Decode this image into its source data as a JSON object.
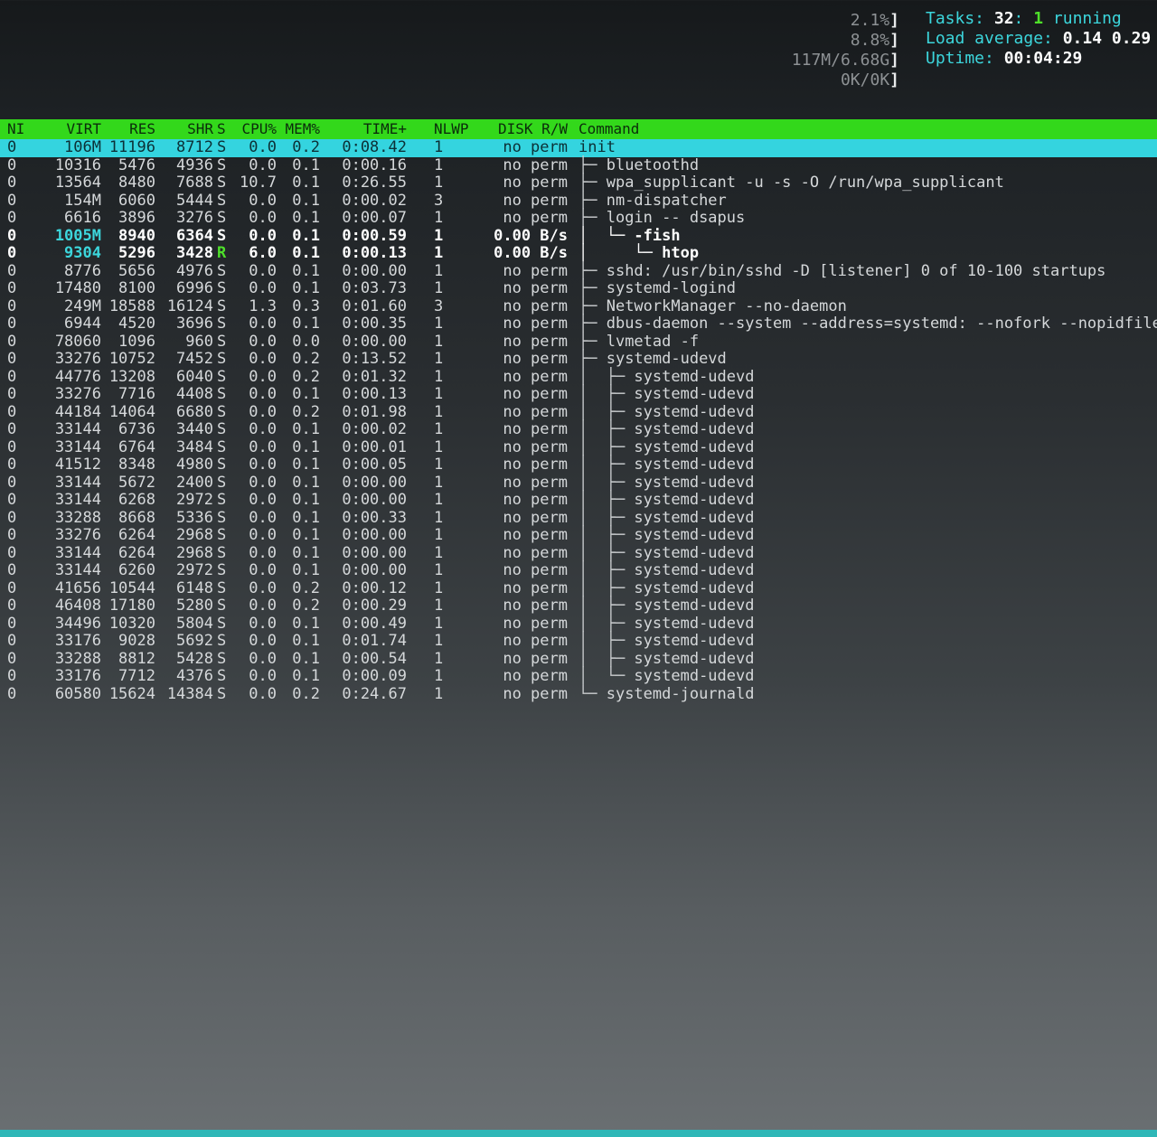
{
  "meters": [
    {
      "value": "2.1%",
      "bracket": "]"
    },
    {
      "value": "8.8%",
      "bracket": "]"
    },
    {
      "value": "117M/6.68G",
      "bracket": "]"
    },
    {
      "value": "0K/0K",
      "bracket": "]"
    }
  ],
  "sysinfo": {
    "tasks_label": "Tasks: ",
    "tasks_count": "32",
    "tasks_sep": ": ",
    "running_count": "1",
    "running_label": " running",
    "load_label": "Load average: ",
    "load_1": "0.14",
    "load_5": "0.29",
    "uptime_label": "Uptime: ",
    "uptime_value": "00:04:29"
  },
  "columns": {
    "ni": "NI",
    "virt": "VIRT",
    "res": "RES",
    "shr": "SHR",
    "s": "S",
    "cpu": "CPU%",
    "mem": "MEM%",
    "time": "TIME+",
    "nlwp": "NLWP",
    "disk": "DISK R/W",
    "command": "Command"
  },
  "processes": [
    {
      "ni": "0",
      "virt": "106M",
      "res": "11196",
      "shr": "8712",
      "s": "S",
      "cpu": "0.0",
      "mem": "0.2",
      "time": "0:08.42",
      "nlwp": "1",
      "disk": "no perm",
      "tree": "",
      "cmd": "init",
      "selected": true
    },
    {
      "ni": "0",
      "virt": "10316",
      "res": "5476",
      "shr": "4936",
      "s": "S",
      "cpu": "0.0",
      "mem": "0.1",
      "time": "0:00.16",
      "nlwp": "1",
      "disk": "no perm",
      "tree": "├─ ",
      "cmd": "bluetoothd"
    },
    {
      "ni": "0",
      "virt": "13564",
      "res": "8480",
      "shr": "7688",
      "s": "S",
      "cpu": "10.7",
      "mem": "0.1",
      "time": "0:26.55",
      "nlwp": "1",
      "disk": "no perm",
      "tree": "├─ ",
      "cmd": "wpa_supplicant -u -s -O /run/wpa_supplicant"
    },
    {
      "ni": "0",
      "virt": "154M",
      "res": "6060",
      "shr": "5444",
      "s": "S",
      "cpu": "0.0",
      "mem": "0.1",
      "time": "0:00.02",
      "nlwp": "3",
      "disk": "no perm",
      "tree": "├─ ",
      "cmd": "nm-dispatcher"
    },
    {
      "ni": "0",
      "virt": "6616",
      "res": "3896",
      "shr": "3276",
      "s": "S",
      "cpu": "0.0",
      "mem": "0.1",
      "time": "0:00.07",
      "nlwp": "1",
      "disk": "no perm",
      "tree": "├─ ",
      "cmd": "login -- dsapus"
    },
    {
      "ni": "0",
      "virt": "1005M",
      "res": "8940",
      "shr": "6364",
      "s": "S",
      "cpu": "0.0",
      "mem": "0.1",
      "time": "0:00.59",
      "nlwp": "1",
      "disk": "0.00 B/s",
      "tree": "│  └─ ",
      "cmd": "-fish",
      "bold": true
    },
    {
      "ni": "0",
      "virt": "9304",
      "res": "5296",
      "shr": "3428",
      "s": "R",
      "cpu": "6.0",
      "mem": "0.1",
      "time": "0:00.13",
      "nlwp": "1",
      "disk": "0.00 B/s",
      "tree": "│     └─ ",
      "cmd": "htop",
      "bold": true
    },
    {
      "ni": "0",
      "virt": "8776",
      "res": "5656",
      "shr": "4976",
      "s": "S",
      "cpu": "0.0",
      "mem": "0.1",
      "time": "0:00.00",
      "nlwp": "1",
      "disk": "no perm",
      "tree": "├─ ",
      "cmd": "sshd: /usr/bin/sshd -D [listener] 0 of 10-100 startups"
    },
    {
      "ni": "0",
      "virt": "17480",
      "res": "8100",
      "shr": "6996",
      "s": "S",
      "cpu": "0.0",
      "mem": "0.1",
      "time": "0:03.73",
      "nlwp": "1",
      "disk": "no perm",
      "tree": "├─ ",
      "cmd": "systemd-logind"
    },
    {
      "ni": "0",
      "virt": "249M",
      "res": "18588",
      "shr": "16124",
      "s": "S",
      "cpu": "1.3",
      "mem": "0.3",
      "time": "0:01.60",
      "nlwp": "3",
      "disk": "no perm",
      "tree": "├─ ",
      "cmd": "NetworkManager --no-daemon"
    },
    {
      "ni": "0",
      "virt": "6944",
      "res": "4520",
      "shr": "3696",
      "s": "S",
      "cpu": "0.0",
      "mem": "0.1",
      "time": "0:00.35",
      "nlwp": "1",
      "disk": "no perm",
      "tree": "├─ ",
      "cmd": "dbus-daemon --system --address=systemd: --nofork --nopidfile"
    },
    {
      "ni": "0",
      "virt": "78060",
      "res": "1096",
      "shr": "960",
      "s": "S",
      "cpu": "0.0",
      "mem": "0.0",
      "time": "0:00.00",
      "nlwp": "1",
      "disk": "no perm",
      "tree": "├─ ",
      "cmd": "lvmetad -f"
    },
    {
      "ni": "0",
      "virt": "33276",
      "res": "10752",
      "shr": "7452",
      "s": "S",
      "cpu": "0.0",
      "mem": "0.2",
      "time": "0:13.52",
      "nlwp": "1",
      "disk": "no perm",
      "tree": "├─ ",
      "cmd": "systemd-udevd"
    },
    {
      "ni": "0",
      "virt": "44776",
      "res": "13208",
      "shr": "6040",
      "s": "S",
      "cpu": "0.0",
      "mem": "0.2",
      "time": "0:01.32",
      "nlwp": "1",
      "disk": "no perm",
      "tree": "│  ├─ ",
      "cmd": "systemd-udevd"
    },
    {
      "ni": "0",
      "virt": "33276",
      "res": "7716",
      "shr": "4408",
      "s": "S",
      "cpu": "0.0",
      "mem": "0.1",
      "time": "0:00.13",
      "nlwp": "1",
      "disk": "no perm",
      "tree": "│  ├─ ",
      "cmd": "systemd-udevd"
    },
    {
      "ni": "0",
      "virt": "44184",
      "res": "14064",
      "shr": "6680",
      "s": "S",
      "cpu": "0.0",
      "mem": "0.2",
      "time": "0:01.98",
      "nlwp": "1",
      "disk": "no perm",
      "tree": "│  ├─ ",
      "cmd": "systemd-udevd"
    },
    {
      "ni": "0",
      "virt": "33144",
      "res": "6736",
      "shr": "3440",
      "s": "S",
      "cpu": "0.0",
      "mem": "0.1",
      "time": "0:00.02",
      "nlwp": "1",
      "disk": "no perm",
      "tree": "│  ├─ ",
      "cmd": "systemd-udevd"
    },
    {
      "ni": "0",
      "virt": "33144",
      "res": "6764",
      "shr": "3484",
      "s": "S",
      "cpu": "0.0",
      "mem": "0.1",
      "time": "0:00.01",
      "nlwp": "1",
      "disk": "no perm",
      "tree": "│  ├─ ",
      "cmd": "systemd-udevd"
    },
    {
      "ni": "0",
      "virt": "41512",
      "res": "8348",
      "shr": "4980",
      "s": "S",
      "cpu": "0.0",
      "mem": "0.1",
      "time": "0:00.05",
      "nlwp": "1",
      "disk": "no perm",
      "tree": "│  ├─ ",
      "cmd": "systemd-udevd"
    },
    {
      "ni": "0",
      "virt": "33144",
      "res": "5672",
      "shr": "2400",
      "s": "S",
      "cpu": "0.0",
      "mem": "0.1",
      "time": "0:00.00",
      "nlwp": "1",
      "disk": "no perm",
      "tree": "│  ├─ ",
      "cmd": "systemd-udevd"
    },
    {
      "ni": "0",
      "virt": "33144",
      "res": "6268",
      "shr": "2972",
      "s": "S",
      "cpu": "0.0",
      "mem": "0.1",
      "time": "0:00.00",
      "nlwp": "1",
      "disk": "no perm",
      "tree": "│  ├─ ",
      "cmd": "systemd-udevd"
    },
    {
      "ni": "0",
      "virt": "33288",
      "res": "8668",
      "shr": "5336",
      "s": "S",
      "cpu": "0.0",
      "mem": "0.1",
      "time": "0:00.33",
      "nlwp": "1",
      "disk": "no perm",
      "tree": "│  ├─ ",
      "cmd": "systemd-udevd"
    },
    {
      "ni": "0",
      "virt": "33276",
      "res": "6264",
      "shr": "2968",
      "s": "S",
      "cpu": "0.0",
      "mem": "0.1",
      "time": "0:00.00",
      "nlwp": "1",
      "disk": "no perm",
      "tree": "│  ├─ ",
      "cmd": "systemd-udevd"
    },
    {
      "ni": "0",
      "virt": "33144",
      "res": "6264",
      "shr": "2968",
      "s": "S",
      "cpu": "0.0",
      "mem": "0.1",
      "time": "0:00.00",
      "nlwp": "1",
      "disk": "no perm",
      "tree": "│  ├─ ",
      "cmd": "systemd-udevd"
    },
    {
      "ni": "0",
      "virt": "33144",
      "res": "6260",
      "shr": "2972",
      "s": "S",
      "cpu": "0.0",
      "mem": "0.1",
      "time": "0:00.00",
      "nlwp": "1",
      "disk": "no perm",
      "tree": "│  ├─ ",
      "cmd": "systemd-udevd"
    },
    {
      "ni": "0",
      "virt": "41656",
      "res": "10544",
      "shr": "6148",
      "s": "S",
      "cpu": "0.0",
      "mem": "0.2",
      "time": "0:00.12",
      "nlwp": "1",
      "disk": "no perm",
      "tree": "│  ├─ ",
      "cmd": "systemd-udevd"
    },
    {
      "ni": "0",
      "virt": "46408",
      "res": "17180",
      "shr": "5280",
      "s": "S",
      "cpu": "0.0",
      "mem": "0.2",
      "time": "0:00.29",
      "nlwp": "1",
      "disk": "no perm",
      "tree": "│  ├─ ",
      "cmd": "systemd-udevd"
    },
    {
      "ni": "0",
      "virt": "34496",
      "res": "10320",
      "shr": "5804",
      "s": "S",
      "cpu": "0.0",
      "mem": "0.1",
      "time": "0:00.49",
      "nlwp": "1",
      "disk": "no perm",
      "tree": "│  ├─ ",
      "cmd": "systemd-udevd"
    },
    {
      "ni": "0",
      "virt": "33176",
      "res": "9028",
      "shr": "5692",
      "s": "S",
      "cpu": "0.0",
      "mem": "0.1",
      "time": "0:01.74",
      "nlwp": "1",
      "disk": "no perm",
      "tree": "│  ├─ ",
      "cmd": "systemd-udevd"
    },
    {
      "ni": "0",
      "virt": "33288",
      "res": "8812",
      "shr": "5428",
      "s": "S",
      "cpu": "0.0",
      "mem": "0.1",
      "time": "0:00.54",
      "nlwp": "1",
      "disk": "no perm",
      "tree": "│  ├─ ",
      "cmd": "systemd-udevd"
    },
    {
      "ni": "0",
      "virt": "33176",
      "res": "7712",
      "shr": "4376",
      "s": "S",
      "cpu": "0.0",
      "mem": "0.1",
      "time": "0:00.09",
      "nlwp": "1",
      "disk": "no perm",
      "tree": "│  └─ ",
      "cmd": "systemd-udevd"
    },
    {
      "ni": "0",
      "virt": "60580",
      "res": "15624",
      "shr": "14384",
      "s": "S",
      "cpu": "0.0",
      "mem": "0.2",
      "time": "0:24.67",
      "nlwp": "1",
      "disk": "no perm",
      "tree": "└─ ",
      "cmd": "systemd-journald"
    }
  ],
  "colors": {
    "header_bg": "#33d81b",
    "selected_bg": "#34d4df",
    "label_cyan": "#3cd6dc",
    "running_green": "#4ee02a"
  }
}
